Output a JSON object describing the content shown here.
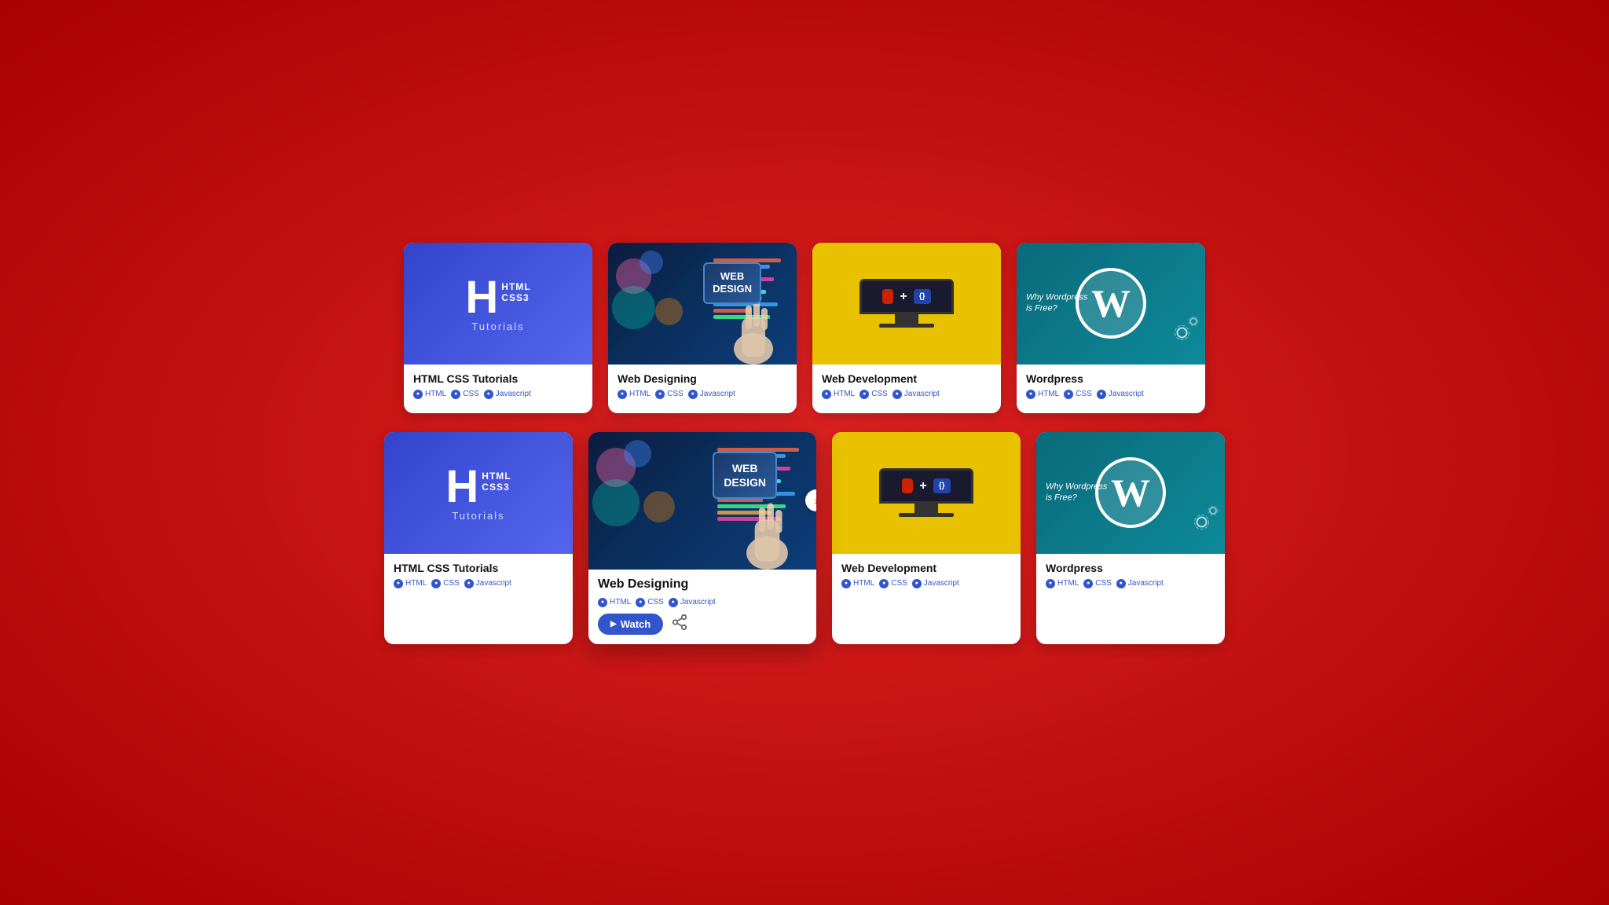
{
  "page": {
    "background": "#cc1111"
  },
  "row1": {
    "cards": [
      {
        "id": "html-css-1",
        "type": "html-css",
        "title": "HTML CSS Tutorials",
        "tags": [
          "HTML",
          "CSS",
          "Javascript"
        ],
        "expanded": false
      },
      {
        "id": "web-design-1",
        "type": "web-design",
        "title": "Web Designing",
        "tags": [
          "HTML",
          "CSS",
          "Javascript"
        ],
        "expanded": false
      },
      {
        "id": "web-dev-1",
        "type": "web-dev",
        "title": "Web Development",
        "tags": [
          "HTML",
          "CSS",
          "Javascript"
        ],
        "expanded": false
      },
      {
        "id": "wordpress-1",
        "type": "wordpress",
        "title": "Wordpress",
        "tags": [
          "HTML",
          "CSS",
          "Javascript"
        ],
        "expanded": false
      }
    ]
  },
  "row2": {
    "cards": [
      {
        "id": "html-css-2",
        "type": "html-css",
        "title": "HTML CSS Tutorials",
        "tags": [
          "HTML",
          "CSS",
          "Javascript"
        ],
        "expanded": false
      },
      {
        "id": "web-design-2",
        "type": "web-design",
        "title": "Web Designing",
        "tags": [
          "HTML",
          "CSS",
          "Javascript"
        ],
        "expanded": true
      },
      {
        "id": "web-dev-2",
        "type": "web-dev",
        "title": "Web Development",
        "tags": [
          "HTML",
          "CSS",
          "Javascript"
        ],
        "expanded": false
      },
      {
        "id": "wordpress-2",
        "type": "wordpress",
        "title": "Wordpress",
        "tags": [
          "HTML",
          "CSS",
          "Javascript"
        ],
        "expanded": false
      }
    ]
  },
  "labels": {
    "html": "HTML",
    "css": "CSS",
    "javascript": "Javascript",
    "watch": "Watch",
    "html_logo_h": "H",
    "html_logo_text": "HTML",
    "css3_logo_text": "CSS3",
    "tutorials": "Tutorials",
    "web_design_badge": "WEB\nDESIGN",
    "why_wordpress": "Why Wordpress is Free?",
    "html_tag": "</>",
    "css_tag": "{}"
  }
}
